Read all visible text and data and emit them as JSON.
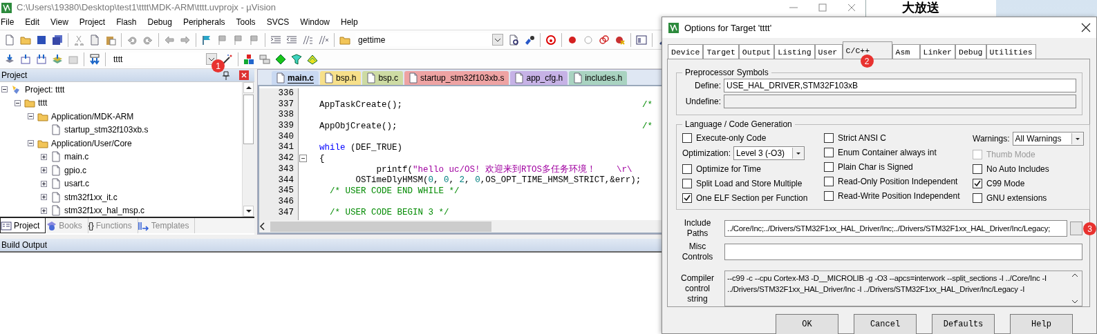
{
  "ide": {
    "title": "C:\\Users\\19380\\Desktop\\test1\\tttt\\MDK-ARM\\tttt.uvprojx - µVision",
    "menu": [
      "File",
      "Edit",
      "View",
      "Project",
      "Flash",
      "Debug",
      "Peripherals",
      "Tools",
      "SVCS",
      "Window",
      "Help"
    ],
    "find_combo": {
      "value": "gettime"
    },
    "target_combo": {
      "value": "tttt",
      "marker": "1"
    },
    "project_pane": {
      "title": "Project",
      "tree": [
        {
          "label": "Project: tttt",
          "kind": "project",
          "expanded": true,
          "children": [
            {
              "label": "tttt",
              "kind": "target",
              "expanded": true,
              "children": [
                {
                  "label": "Application/MDK-ARM",
                  "kind": "group",
                  "expanded": true,
                  "children": [
                    {
                      "label": "startup_stm32f103xb.s",
                      "kind": "file"
                    }
                  ]
                },
                {
                  "label": "Application/User/Core",
                  "kind": "group",
                  "expanded": true,
                  "children": [
                    {
                      "label": "main.c",
                      "kind": "file",
                      "expanded": false
                    },
                    {
                      "label": "gpio.c",
                      "kind": "file",
                      "expanded": false
                    },
                    {
                      "label": "usart.c",
                      "kind": "file",
                      "expanded": false
                    },
                    {
                      "label": "stm32f1xx_it.c",
                      "kind": "file",
                      "expanded": false
                    },
                    {
                      "label": "stm32f1xx_hal_msp.c",
                      "kind": "file",
                      "expanded": false
                    }
                  ]
                }
              ]
            }
          ]
        }
      ],
      "tabs": [
        {
          "label": "Project",
          "kind": "project",
          "selected": true
        },
        {
          "label": "Books",
          "kind": "books",
          "selected": false
        },
        {
          "label": "{}",
          "kind": "functions",
          "selected": false,
          "text": "Functions"
        },
        {
          "label": "Templates",
          "kind": "templates",
          "selected": false
        }
      ]
    },
    "editor": {
      "tabs": [
        {
          "label": "main.c",
          "selected": true,
          "color": "#c9d9f2"
        },
        {
          "label": "bsp.h",
          "selected": false,
          "color": "#f7e08a"
        },
        {
          "label": "bsp.c",
          "selected": false,
          "color": "#cddba3"
        },
        {
          "label": "startup_stm32f103xb.s",
          "selected": false,
          "color": "#eea3a3"
        },
        {
          "label": "app_cfg.h",
          "selected": false,
          "color": "#c6b2e6"
        },
        {
          "label": "includes.h",
          "selected": false,
          "color": "#a9d3c1"
        }
      ],
      "lines": [
        {
          "number": "336",
          "fold": false
        },
        {
          "number": "337",
          "fold": false,
          "segments": [
            {
              "kind": "plain",
              "text": "AppTaskCreate();"
            },
            {
              "kind": "trailing",
              "text": "/*"
            }
          ]
        },
        {
          "number": "338",
          "fold": false
        },
        {
          "number": "339",
          "fold": false,
          "segments": [
            {
              "kind": "plain",
              "text": "AppObjCreate();"
            },
            {
              "kind": "trailing",
              "text": "/*"
            }
          ]
        },
        {
          "number": "340",
          "fold": false
        },
        {
          "number": "341",
          "fold": false,
          "segments": [
            {
              "kind": "keyword",
              "text": "while"
            },
            {
              "kind": "plain",
              "text": " (DEF_TRUE)"
            }
          ]
        },
        {
          "number": "342",
          "fold": true,
          "segments": [
            {
              "kind": "plain",
              "text": "{"
            }
          ]
        },
        {
          "number": "343",
          "fold": false,
          "segments": [
            {
              "kind": "plain",
              "text": "           printf("
            },
            {
              "kind": "string",
              "text": "\"hello uc/OS! 欢迎来到RTOS多任务环境！    \\r\\"
            }
          ]
        },
        {
          "number": "344",
          "fold": false,
          "segments": [
            {
              "kind": "plain",
              "text": "       OSTimeDlyHMSM("
            },
            {
              "kind": "number",
              "text": "0"
            },
            {
              "kind": "plain",
              "text": ", "
            },
            {
              "kind": "number",
              "text": "0"
            },
            {
              "kind": "plain",
              "text": ", "
            },
            {
              "kind": "number",
              "text": "2"
            },
            {
              "kind": "plain",
              "text": ", "
            },
            {
              "kind": "number",
              "text": "0"
            },
            {
              "kind": "plain",
              "text": ",OS_OPT_TIME_HMSM_STRICT,&err);"
            }
          ]
        },
        {
          "number": "345",
          "fold": false,
          "segments": [
            {
              "kind": "comment",
              "text": "  /* USER CODE END WHILE */"
            }
          ]
        },
        {
          "number": "346",
          "fold": false
        },
        {
          "number": "347",
          "fold": false,
          "segments": [
            {
              "kind": "comment",
              "text": "  /* USER CODE BEGIN 3 */"
            }
          ]
        }
      ]
    },
    "build_output": {
      "title": "Build Output"
    }
  },
  "background_page": {
    "heading": "大放送"
  },
  "dialog": {
    "title": "Options for Target 'tttt'",
    "tabs": [
      {
        "label": "Device",
        "selected": false
      },
      {
        "label": "Target",
        "selected": false
      },
      {
        "label": "Output",
        "selected": false
      },
      {
        "label": "Listing",
        "selected": false
      },
      {
        "label": "User",
        "selected": false
      },
      {
        "label": "C/C++",
        "selected": true,
        "marker": "2"
      },
      {
        "label": "Asm",
        "selected": false
      },
      {
        "label": "Linker",
        "selected": false
      },
      {
        "label": "Debug",
        "selected": false
      },
      {
        "label": "Utilities",
        "selected": false
      }
    ],
    "preprocessor": {
      "title": "Preprocessor Symbols",
      "define": {
        "label": "Define:",
        "value": "USE_HAL_DRIVER,STM32F103xB"
      },
      "undefine": {
        "label": "Undefine:",
        "disabled": true
      }
    },
    "language": {
      "title": "Language / Code Generation",
      "columns": [
        [
          {
            "kind": "checkbox",
            "label": "Execute-only Code",
            "checked": false,
            "disabled": false
          },
          {
            "kind": "select",
            "label": "Optimization:",
            "value": "Level 3 (-O3)"
          },
          {
            "kind": "checkbox",
            "label": "Optimize for Time",
            "checked": false,
            "disabled": false
          },
          {
            "kind": "checkbox",
            "label": "Split Load and Store Multiple",
            "checked": false,
            "disabled": false
          },
          {
            "kind": "checkbox",
            "label": "One ELF Section per Function",
            "checked": true,
            "disabled": false
          }
        ],
        [
          {
            "kind": "checkbox",
            "label": "Strict ANSI C",
            "checked": false,
            "disabled": false
          },
          {
            "kind": "checkbox",
            "label": "Enum Container always int",
            "checked": false,
            "disabled": false
          },
          {
            "kind": "checkbox",
            "label": "Plain Char is Signed",
            "checked": false,
            "disabled": false
          },
          {
            "kind": "checkbox",
            "label": "Read-Only Position Independent",
            "checked": false,
            "disabled": false
          },
          {
            "kind": "checkbox",
            "label": "Read-Write Position Independent",
            "checked": false,
            "disabled": false
          }
        ],
        [
          {
            "kind": "select",
            "label": "Warnings:",
            "value": "All Warnings"
          },
          {
            "kind": "checkbox",
            "label": "Thumb Mode",
            "checked": false,
            "disabled": true
          },
          {
            "kind": "checkbox",
            "label": "No Auto Includes",
            "checked": false,
            "disabled": false
          },
          {
            "kind": "checkbox",
            "label": "C99 Mode",
            "checked": true,
            "disabled": false
          },
          {
            "kind": "checkbox",
            "label": "GNU extensions",
            "checked": false,
            "disabled": false
          }
        ]
      ]
    },
    "include_paths": {
      "label": "Include Paths",
      "value": "../Core/Inc;../Drivers/STM32F1xx_HAL_Driver/Inc;../Drivers/STM32F1xx_HAL_Driver/Inc/Legacy;",
      "marker": "3"
    },
    "misc_controls": {
      "label": "Misc Controls"
    },
    "compiler_string": {
      "label": "Compiler control string",
      "value": "--c99 -c --cpu Cortex-M3 -D__MICROLIB -g -O3 --apcs=interwork --split_sections -I ../Core/Inc -I ../Drivers/STM32F1xx_HAL_Driver/Inc -I ../Drivers/STM32F1xx_HAL_Driver/Inc/Legacy -I"
    },
    "buttons": [
      "OK",
      "Cancel",
      "Defaults",
      "Help"
    ]
  }
}
